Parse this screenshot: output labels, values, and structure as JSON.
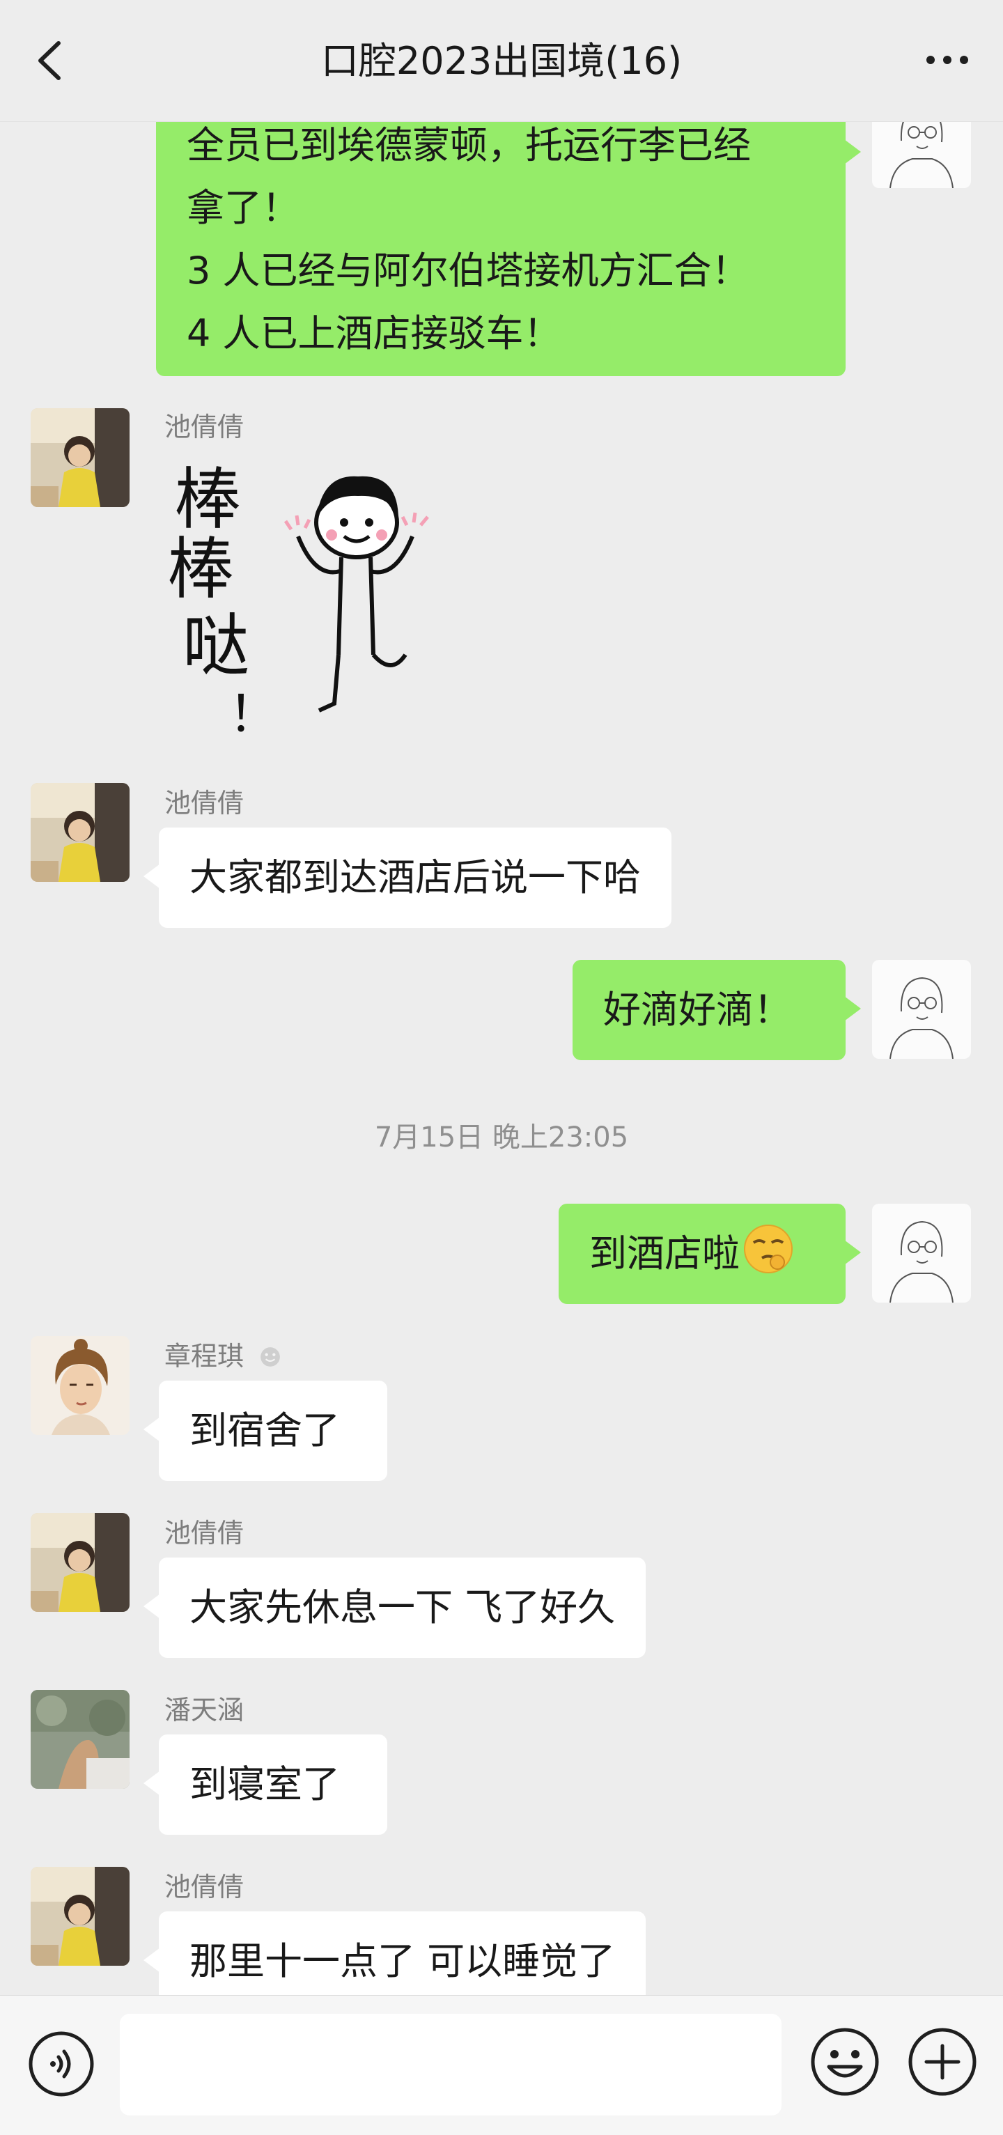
{
  "header": {
    "title": "口腔2023出国境(16)",
    "back_icon": "chevron-left-icon",
    "more_icon": "ellipsis-icon"
  },
  "messages": [
    {
      "type": "text",
      "from": "me",
      "lines": [
        "全员已到埃德蒙顿，托运行李已经",
        "拿了！",
        "3 人已经与阿尔伯塔接机方汇合！",
        "4 人已上酒店接驳车！"
      ]
    },
    {
      "type": "sticker",
      "from": "them",
      "sender": "池倩倩",
      "sticker_text": [
        "棒",
        "棒",
        "哒",
        "！"
      ]
    },
    {
      "type": "text",
      "from": "them",
      "sender": "池倩倩",
      "text": "大家都到达酒店后说一下哈"
    },
    {
      "type": "text",
      "from": "me",
      "text": "好滴好滴！"
    },
    {
      "type": "timestamp",
      "text": "7月15日 晚上23:05"
    },
    {
      "type": "text",
      "from": "me",
      "text": "到酒店啦",
      "emoji": "smirk-emoji"
    },
    {
      "type": "text",
      "from": "them",
      "sender": "章程琪",
      "text": "到宿舍了"
    },
    {
      "type": "text",
      "from": "them",
      "sender": "池倩倩",
      "text": "大家先休息一下 飞了好久"
    },
    {
      "type": "text",
      "from": "them",
      "sender": "潘天涵",
      "text": "到寝室了"
    },
    {
      "type": "text",
      "from": "them",
      "sender": "池倩倩",
      "text": "那里十一点了 可以睡觉了"
    }
  ],
  "input_bar": {
    "placeholder": "",
    "voice_icon": "voice-icon",
    "emoji_icon": "emoji-icon",
    "plus_icon": "plus-icon"
  },
  "colors": {
    "background": "#ededed",
    "my_bubble": "#95ec69",
    "their_bubble": "#ffffff",
    "sender_name": "#7d7d7d"
  }
}
